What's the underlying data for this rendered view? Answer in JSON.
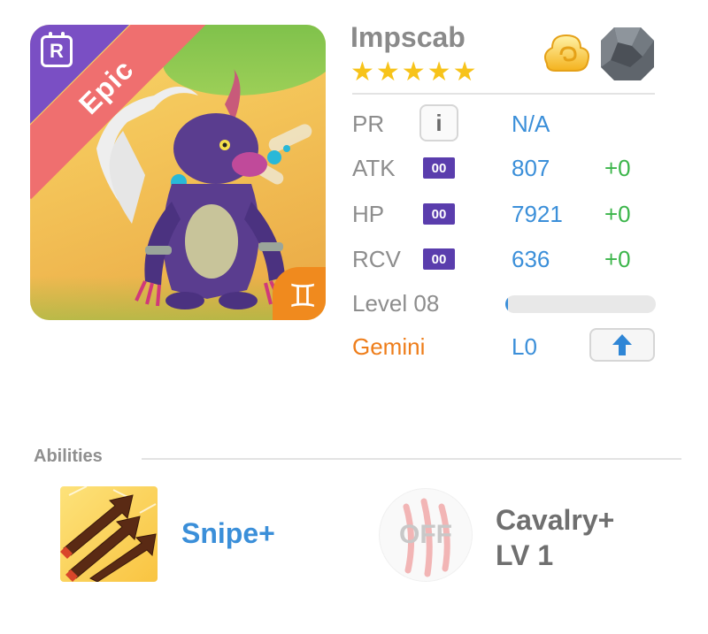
{
  "monster": {
    "name": "Impscab",
    "stars": "★★★★★",
    "rarity_letter": "R",
    "rarity_label": "Epic",
    "zodiac_symbol": "♊",
    "element_icon": "cloud-swirl-icon",
    "stone_icon": "stone-icon"
  },
  "stats": {
    "pr": {
      "label": "PR",
      "info_symbol": "i",
      "value": "N/A"
    },
    "atk": {
      "label": "ATK",
      "badge": "00",
      "value": "807",
      "bonus": "+0"
    },
    "hp": {
      "label": "HP",
      "badge": "00",
      "value": "7921",
      "bonus": "+0"
    },
    "rcv": {
      "label": "RCV",
      "badge": "00",
      "value": "636",
      "bonus": "+0"
    },
    "level": {
      "label": "Level 08",
      "progress": 0.02
    },
    "sign": {
      "label": "Gemini",
      "level": "L0",
      "upgrade_icon": "arrow-up-icon"
    }
  },
  "abilities": {
    "title": "Abilities",
    "items": [
      {
        "name": "Snipe+",
        "icon": "snipe-arrows-icon"
      },
      {
        "name_line1": "Cavalry+",
        "name_line2": "LV 1",
        "status": "OFF",
        "icon": "claw-marks-icon"
      }
    ]
  },
  "colors": {
    "blue_value": "#3b8fd9",
    "green_bonus": "#3bb54a",
    "orange_sign": "#ee7d1a",
    "epic_ribbon": "#ef6f6f",
    "rarity_corner": "#7a4fc4",
    "stat_badge": "#5a3dad",
    "star": "#f7c31a"
  }
}
